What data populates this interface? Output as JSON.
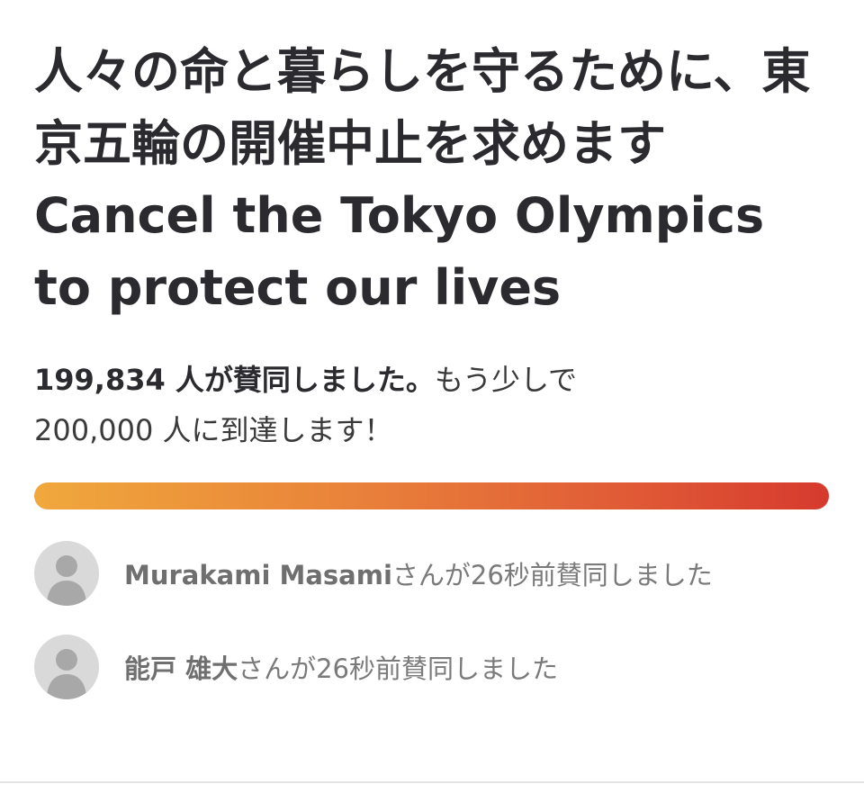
{
  "petition": {
    "title": "人々の命と暮らしを守るために、東京五輪の開催中止を求めます Cancel the Tokyo Olympics to protect our lives",
    "signature_count_text": "199,834 人が賛同しました。",
    "goal_text_line1": "もう少しで",
    "goal_text_line2": "200,000 人に到達します！",
    "signatures": 199834,
    "goal": 200000,
    "progress_fraction": 0.999
  },
  "colors": {
    "progress_start": "#f0a83c",
    "progress_end": "#d63a2e",
    "text_dark": "#2b2a2e",
    "text_muted": "#7a7a7a"
  },
  "recent_supporters": [
    {
      "name": "Murakami Masami",
      "suffix": "さんが26秒前賛同しました",
      "icon": "avatar-placeholder-icon"
    },
    {
      "name": "能戸 雄大",
      "suffix": "さんが26秒前賛同しました",
      "icon": "avatar-placeholder-icon"
    }
  ]
}
